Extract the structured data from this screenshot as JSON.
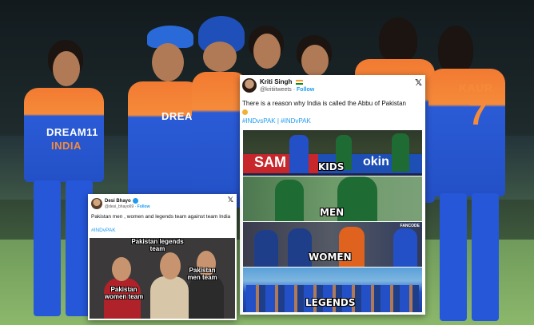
{
  "background": {
    "jerseys": {
      "left_sponsor": "DREAM11",
      "left_team": "INDIA",
      "center_sponsor": "DREA",
      "right_name": "KAUR",
      "right_number": "7"
    }
  },
  "tweet_main": {
    "author": "Kriti Singh",
    "handle": "@kritiitweets",
    "follow_label": "Follow",
    "text": "There is a reason why India is called the Abbu of Pakistan",
    "hashtags": "#INDvsPAK | #INDvPAK",
    "panels": [
      {
        "caption": "KIDS",
        "banner_left": "SAM",
        "banner_right": "okin"
      },
      {
        "caption": "MEN"
      },
      {
        "caption": "WOMEN",
        "badge": "FANCODE"
      },
      {
        "caption": "LEGENDS"
      }
    ]
  },
  "tweet_small": {
    "author": "Desi Bhayo",
    "handle": "@desi_bhayo69",
    "follow_label": "Follow",
    "text": "Pakistan men , women and legends team against team India",
    "hashtag": "#INDvPAK",
    "labels": {
      "legends": "Pakistan legends team",
      "men": "Pakistan men team",
      "women": "Pakistan women team"
    }
  },
  "colors": {
    "india_blue": "#2350c6",
    "india_orange": "#f27a32",
    "twitter_blue": "#1d9bf0",
    "pakistan_green": "#1f6b34"
  }
}
